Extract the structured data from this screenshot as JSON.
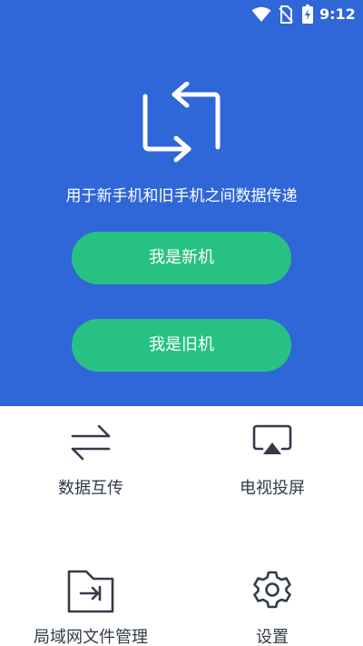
{
  "status_bar": {
    "time": "9:12",
    "icons": [
      "wifi-icon",
      "no-sim-icon",
      "battery-charging-icon"
    ]
  },
  "hero": {
    "icon": "sync-arrows-icon",
    "tagline": "用于新手机和旧手机之间数据传递",
    "new_phone_button": "我是新机",
    "old_phone_button": "我是旧机",
    "background_color": "#2f66d8",
    "button_color": "#27c283"
  },
  "features": [
    {
      "label": "数据互传",
      "icon": "transfer-arrows-icon"
    },
    {
      "label": "电视投屏",
      "icon": "screen-cast-icon"
    },
    {
      "label": "局域网文件管理",
      "icon": "folder-export-icon"
    },
    {
      "label": "设置",
      "icon": "gear-icon"
    }
  ]
}
